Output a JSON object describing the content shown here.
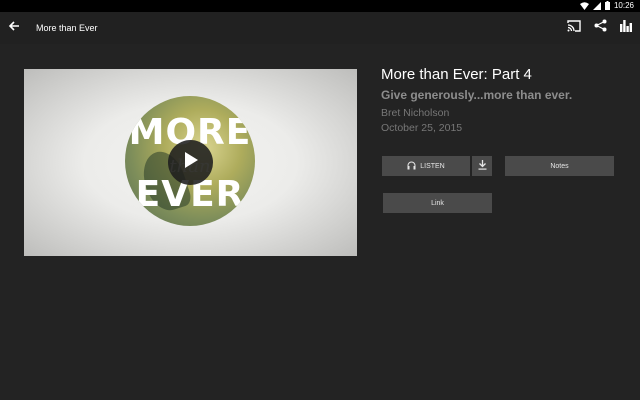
{
  "status_bar": {
    "time": "10:26"
  },
  "app_bar": {
    "title": "More than Ever",
    "icons": [
      "back-arrow-icon",
      "cast-icon",
      "share-icon",
      "equalizer-icon"
    ]
  },
  "video": {
    "artwork_text_top": "MORE",
    "artwork_text_middle": "than",
    "artwork_text_bottom": "EVER",
    "play_icon": "play-icon"
  },
  "sermon": {
    "title": "More than Ever: Part 4",
    "subtitle": "Give generously...more than ever.",
    "speaker": "Bret Nicholson",
    "date": "October 25, 2015"
  },
  "buttons": {
    "listen_label": "LISTEN",
    "listen_icon": "headphones-icon",
    "download_icon": "download-icon",
    "notes_label": "Notes",
    "link_label": "Link"
  },
  "colors": {
    "background": "#232323",
    "button": "#4a4a4a",
    "subtitle": "#8d8d8d",
    "meta": "#777777"
  }
}
